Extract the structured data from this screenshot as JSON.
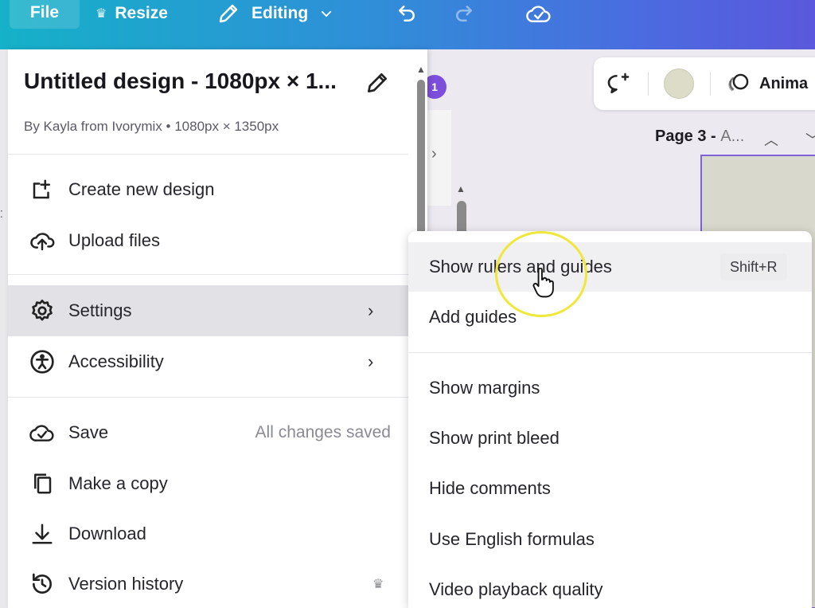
{
  "topbar": {
    "file_label": "File",
    "resize_label": "Resize",
    "editing_label": "Editing"
  },
  "file_menu": {
    "title": "Untitled design - 1080px × 1...",
    "subtitle": "By Kayla from Ivorymix • 1080px × 1350px",
    "items": [
      {
        "label": "Create new design",
        "icon": "add-design-icon"
      },
      {
        "label": "Upload files",
        "icon": "upload-cloud-icon"
      },
      {
        "label": "Settings",
        "icon": "gear-icon",
        "has_submenu": true,
        "active": true
      },
      {
        "label": "Accessibility",
        "icon": "accessibility-icon",
        "has_submenu": true
      },
      {
        "label": "Save",
        "icon": "cloud-check-icon",
        "status": "All changes saved"
      },
      {
        "label": "Make a copy",
        "icon": "copy-icon"
      },
      {
        "label": "Download",
        "icon": "download-icon"
      },
      {
        "label": "Version history",
        "icon": "history-icon",
        "premium": true
      }
    ]
  },
  "settings_submenu": {
    "items": [
      {
        "label": "Show rulers and guides",
        "shortcut": "Shift+R",
        "hovered": true
      },
      {
        "label": "Add guides"
      },
      {
        "label": "Show margins"
      },
      {
        "label": "Show print bleed"
      },
      {
        "label": "Hide comments"
      },
      {
        "label": "Use English formulas"
      },
      {
        "label": "Video playback quality"
      }
    ]
  },
  "canvas": {
    "toolbar_animate_label": "Anima",
    "page_label": "Page 3 - ",
    "page_label_sub": "A...",
    "badge_count": "1",
    "swatch_color": "#dcdcc8"
  },
  "colors": {
    "topbar_gradient_start": "#15b1c8",
    "topbar_gradient_end": "#5a58dc",
    "cursor_highlight": "#efe83a",
    "page_frame_border": "#7d63d6"
  }
}
